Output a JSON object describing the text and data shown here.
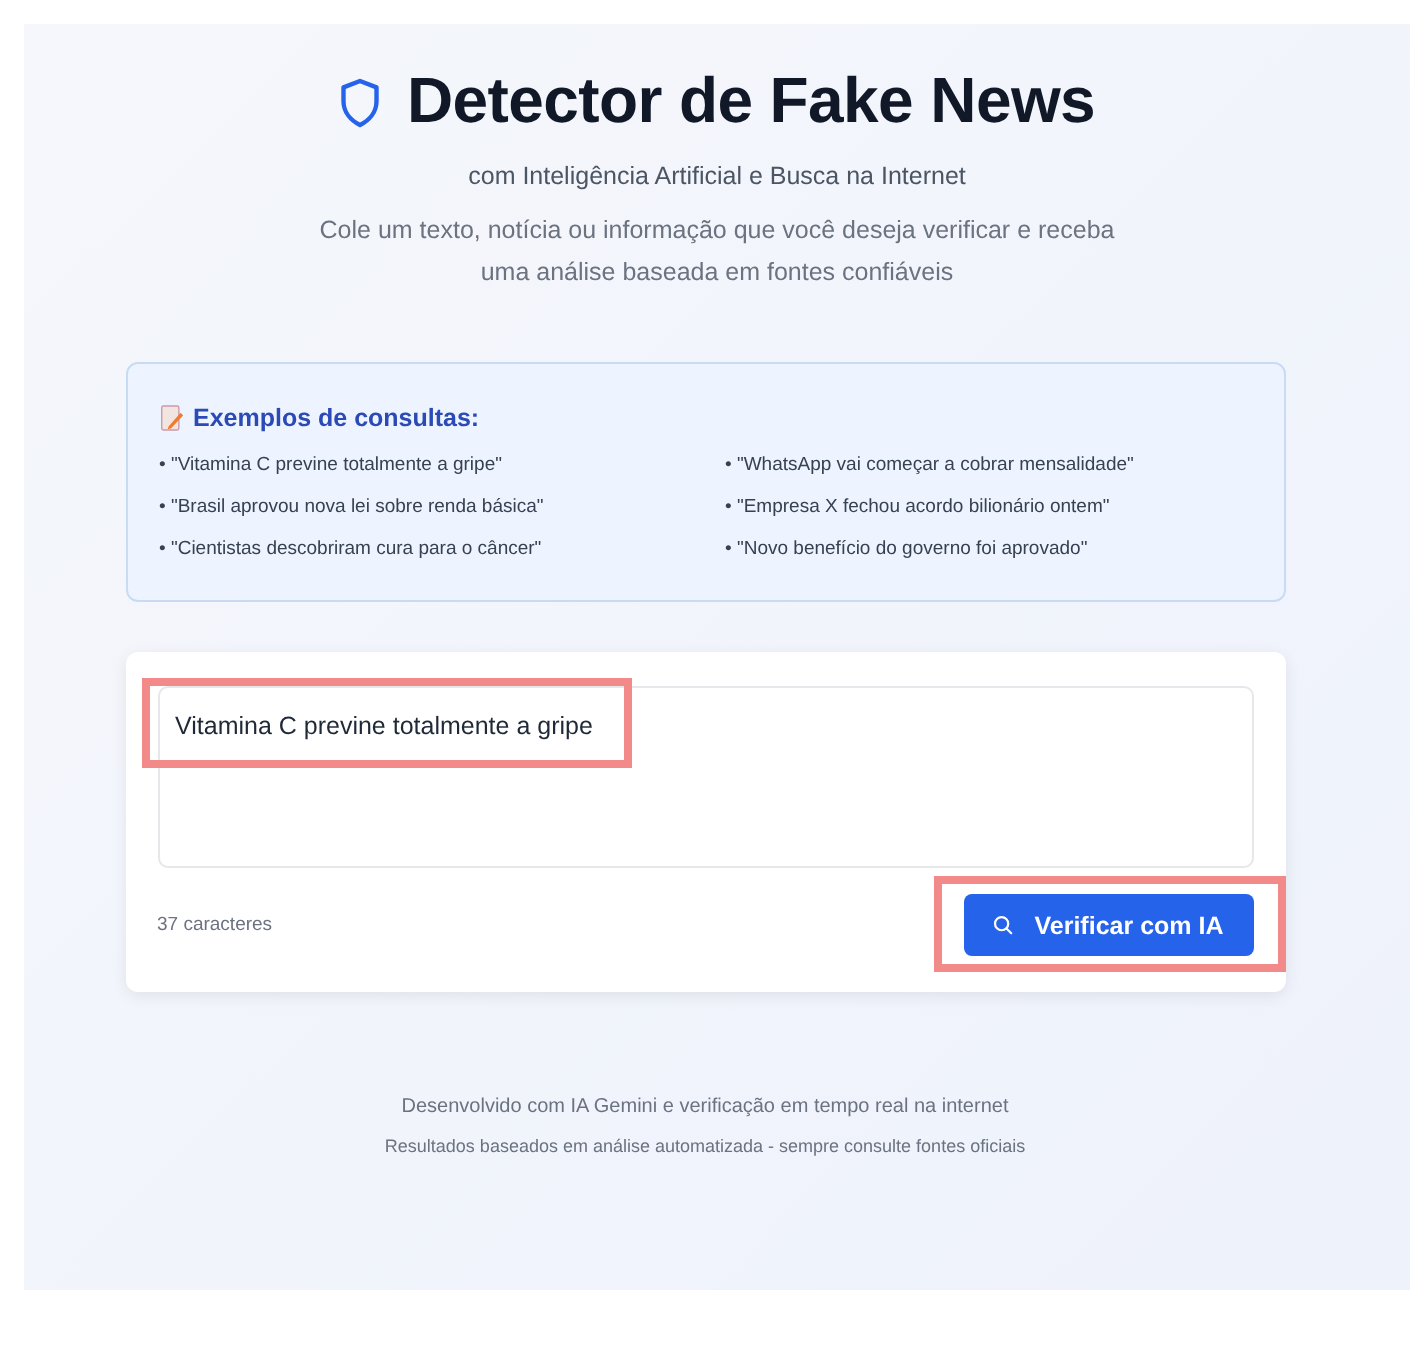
{
  "header": {
    "title": "Detector de Fake News",
    "subtitle": "com Inteligência Artificial e Busca na Internet",
    "description": "Cole um texto, notícia ou informação que você deseja verificar e receba uma análise baseada em fontes confiáveis"
  },
  "examples": {
    "title": "Exemplos de consultas:",
    "items": [
      "• \"Vitamina C previne totalmente a gripe\"",
      "• \"WhatsApp vai começar a cobrar mensalidade\"",
      "• \"Brasil aprovou nova lei sobre renda básica\"",
      "• \"Empresa X fechou acordo bilionário ontem\"",
      "• \"Cientistas descobriram cura para o câncer\"",
      "• \"Novo benefício do governo foi aprovado\""
    ]
  },
  "input": {
    "value": "Vitamina C previne totalmente a gripe",
    "highlighted": true,
    "char_count": "37 caracteres"
  },
  "button": {
    "label": "Verificar com IA",
    "highlighted": true
  },
  "footer": [
    "Desenvolvido com IA Gemini e verificação em tempo real na internet",
    "Resultados baseados em análise automatizada - sempre consulte fontes oficiais"
  ]
}
